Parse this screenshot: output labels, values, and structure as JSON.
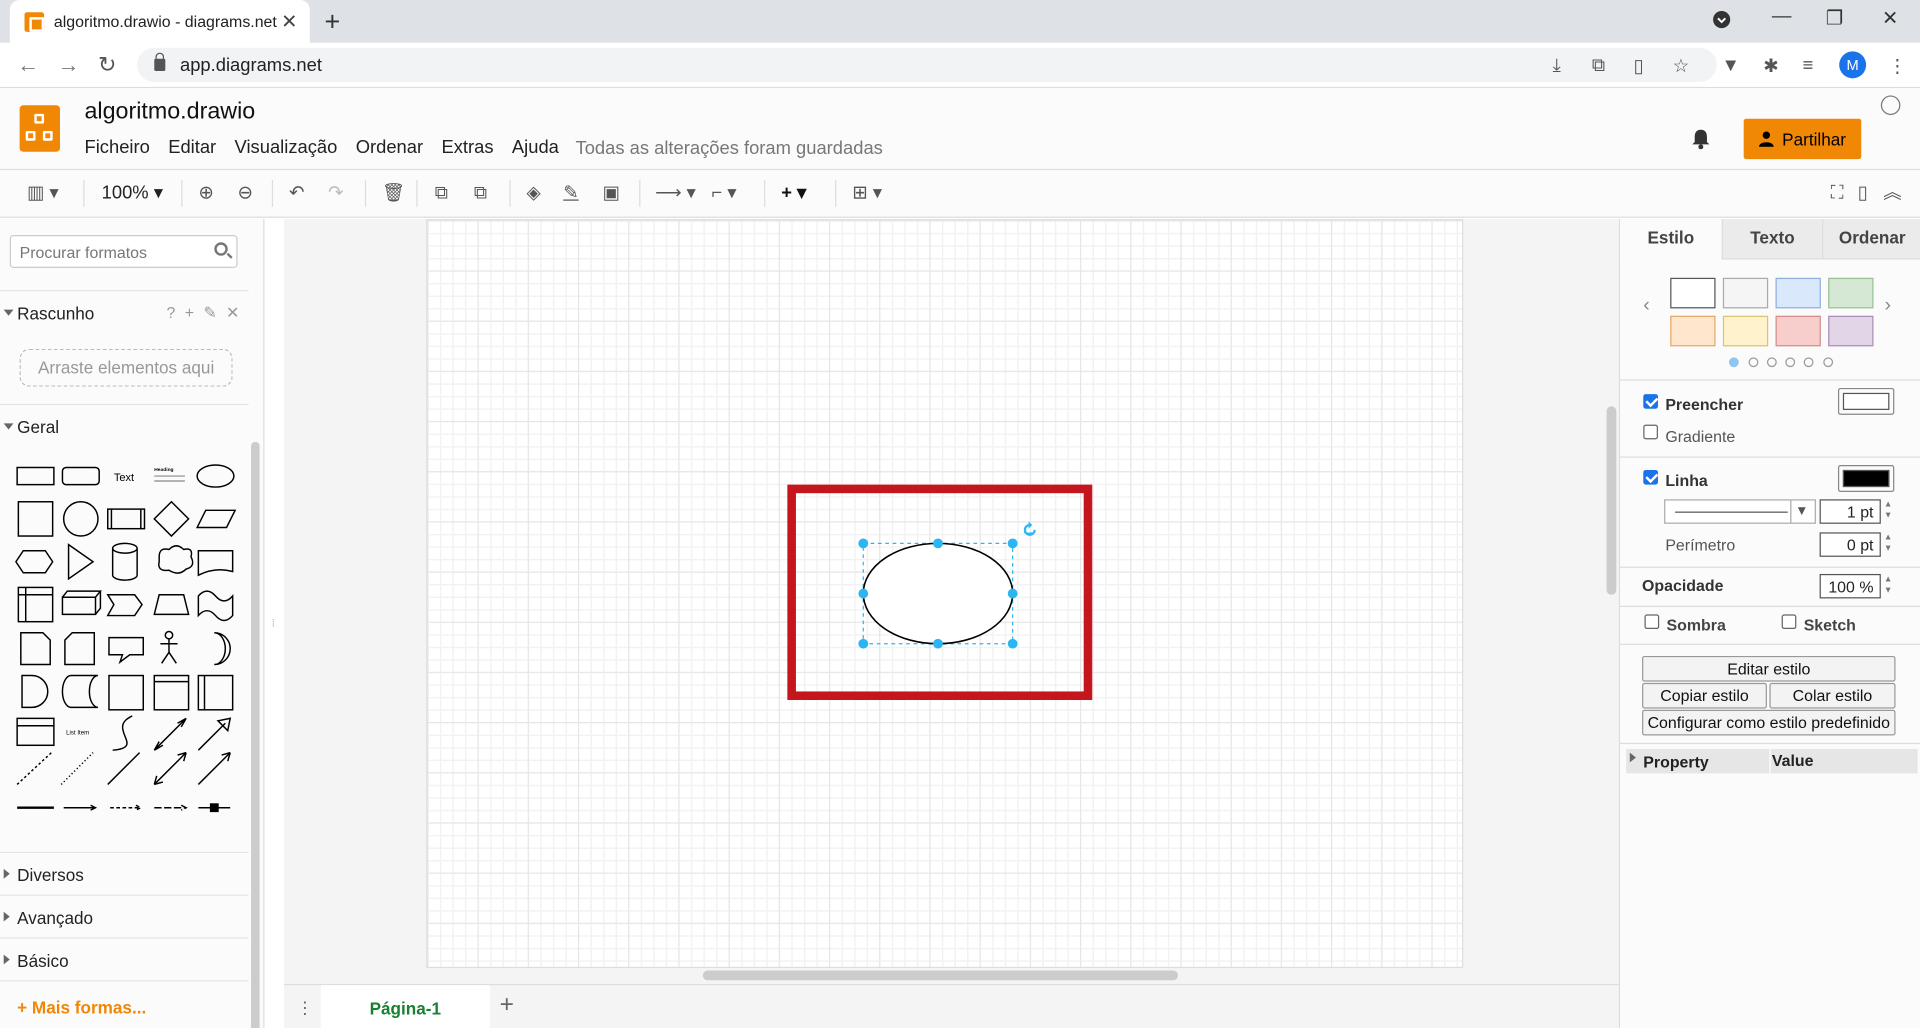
{
  "browser": {
    "tab_title": "algoritmo.drawio - diagrams.net",
    "url": "app.diagrams.net",
    "profile_initial": "M"
  },
  "app": {
    "doc_title": "algoritmo.drawio",
    "menu": [
      "Ficheiro",
      "Editar",
      "Visualização",
      "Ordenar",
      "Extras",
      "Ajuda"
    ],
    "status": "Todas as alterações foram guardadas",
    "share_label": "Partilhar",
    "accent": "#f08705"
  },
  "toolbar": {
    "zoom": "100%"
  },
  "left_panel": {
    "search_placeholder": "Procurar formatos",
    "scratchpad_title": "Rascunho",
    "scratchpad_tools": "? + ✎ ✕",
    "dropzone": "Arraste elementos aqui",
    "general_title": "Geral",
    "shape_text": "Text",
    "shape_heading": "Heading",
    "shape_list_item": "List Item",
    "sections": [
      "Diversos",
      "Avançado",
      "Básico"
    ],
    "more_shapes": "+ Mais formas..."
  },
  "pages": {
    "active": "Página-1",
    "add": "+"
  },
  "right_panel": {
    "tabs": [
      "Estilo",
      "Texto",
      "Ordenar"
    ],
    "swatches": [
      "#ffffff",
      "#f5f5f5",
      "#dae8fc",
      "#d5e8d4",
      "#ffe6cc",
      "#fff2cc",
      "#f8cecc",
      "#e1d5e7"
    ],
    "fill_label": "Preencher",
    "gradient_label": "Gradiente",
    "line_label": "Linha",
    "line_width": "1 pt",
    "perimeter_label": "Perímetro",
    "perimeter_value": "0 pt",
    "opacity_label": "Opacidade",
    "opacity_value": "100 %",
    "shadow_label": "Sombra",
    "sketch_label": "Sketch",
    "edit_style": "Editar estilo",
    "copy_style": "Copiar estilo",
    "paste_style": "Colar estilo",
    "set_default": "Configurar como estilo predefinido",
    "prop_header": "Property",
    "value_header": "Value"
  },
  "canvas": {
    "highlight_color": "#c4161c",
    "selection_color": "#29b6f2"
  }
}
